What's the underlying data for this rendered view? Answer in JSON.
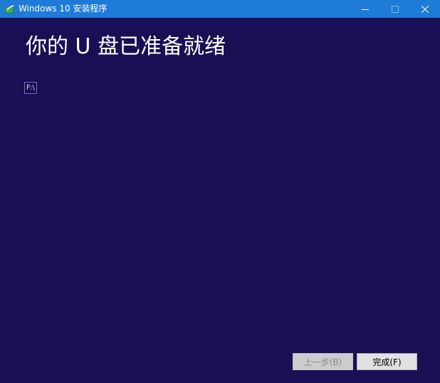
{
  "window": {
    "title": "Windows 10 安装程序",
    "controls": {
      "minimize_icon": "minimize-icon",
      "maximize_icon": "maximize-icon",
      "close_icon": "close-icon"
    }
  },
  "main": {
    "heading": "你的 U 盘已准备就绪",
    "drive": "F:\\"
  },
  "footer": {
    "back_label": "上一步(B)",
    "finish_label": "完成(F)"
  },
  "colors": {
    "background": "#1a0e55",
    "titlebar": "#1e7bd7"
  }
}
